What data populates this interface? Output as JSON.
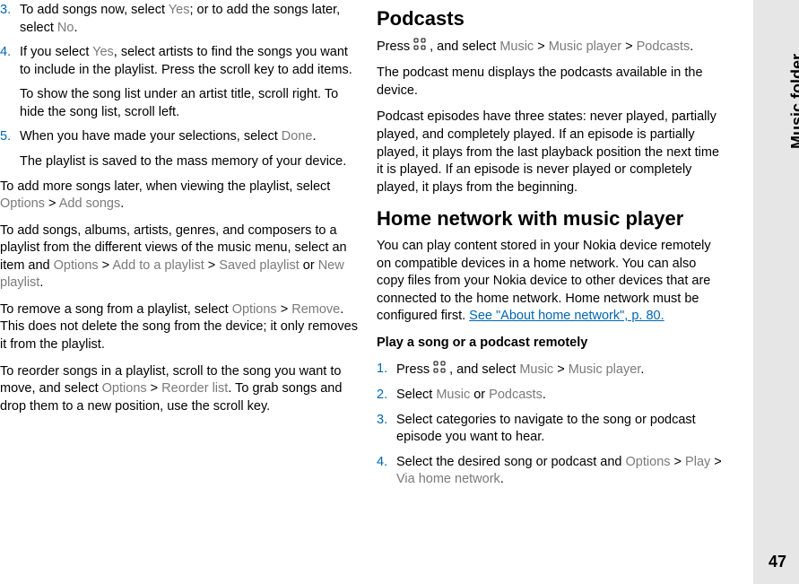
{
  "left_col": {
    "step3": {
      "num": "3.",
      "pre": "To add songs now, select ",
      "yes": "Yes",
      "mid": "; or to add the songs later, select ",
      "no": "No",
      "post": "."
    },
    "step4": {
      "num": "4.",
      "pre": "If you select ",
      "yes": "Yes",
      "post": ", select artists to find the songs you want to include in the playlist. Press the scroll key to add items.",
      "sub": "To show the song list under an artist title, scroll right. To hide the song list, scroll left."
    },
    "step5": {
      "num": "5.",
      "pre": "When you have made your selections, select ",
      "done": "Done",
      "post": ".",
      "sub": "The playlist is saved to the mass memory of your device."
    },
    "p1": {
      "pre": "To add more songs later, when viewing the playlist, select ",
      "opt": "Options",
      "gt": " > ",
      "add": " Add songs",
      "post": "."
    },
    "p2": {
      "pre": "To add songs, albums, artists, genres, and composers to a playlist from the different views of the music menu, select an item and ",
      "opt": "Options",
      "gt": " > ",
      "add": " Add to a playlist",
      "gt2": " > ",
      "saved": " Saved playlist",
      "or": " or ",
      "new": "New playlist",
      "post": "."
    },
    "p3": {
      "pre": "To remove a song from a playlist, select ",
      "opt": "Options",
      "gt": " > ",
      "remove": "Remove",
      "post": ". This does not delete the song from the device; it only removes it from the playlist."
    },
    "p4": {
      "pre": "To reorder songs in a playlist, scroll to the song you want to move, and select ",
      "opt": "Options",
      "gt": " > ",
      "reorder": " Reorder list",
      "post": ". To grab songs and drop them to a new position, use the scroll key."
    }
  },
  "right_col": {
    "h_podcasts": "Podcasts",
    "podcast_press": {
      "pre": "Press ",
      "mid": " , and select ",
      "music": "Music",
      "gt": " > ",
      "mp": " Music player",
      "gt2": " > ",
      "podcasts": "Podcasts",
      "post": "."
    },
    "podcast_p1": "The podcast menu displays the podcasts available in the device.",
    "podcast_p2": "Podcast episodes have three states: never played, partially played, and completely played. If an episode is partially played, it plays from the last playback position the next time it is played. If an episode is never played or completely played, it plays from the beginning.",
    "h_home": "Home network with music player",
    "home_p1_pre": "You can play content stored in your Nokia device remotely on compatible devices in a home network. You can also copy files from your Nokia device to other devices that are connected to the home network. Home network must be configured first. ",
    "home_link": "See \"About home network\", p. 80.",
    "h_play": "Play a song or a podcast remotely",
    "s1": {
      "num": "1.",
      "pre": "Press ",
      "mid": " , and select ",
      "music": "Music",
      "gt": " > ",
      "mp": " Music player",
      "post": "."
    },
    "s2": {
      "num": "2.",
      "pre": "Select ",
      "music": "Music",
      "or": " or ",
      "podcasts": "Podcasts",
      "post": "."
    },
    "s3": {
      "num": "3.",
      "txt": "Select categories to navigate to the song or podcast episode you want to hear."
    },
    "s4": {
      "num": "4.",
      "pre": "Select the desired song or podcast and ",
      "opt": "Options",
      "gt": " > ",
      "play": " Play",
      "gt2": " > ",
      "via": " Via home network",
      "post": "."
    }
  },
  "side": {
    "label": "Music folder",
    "page": "47"
  }
}
